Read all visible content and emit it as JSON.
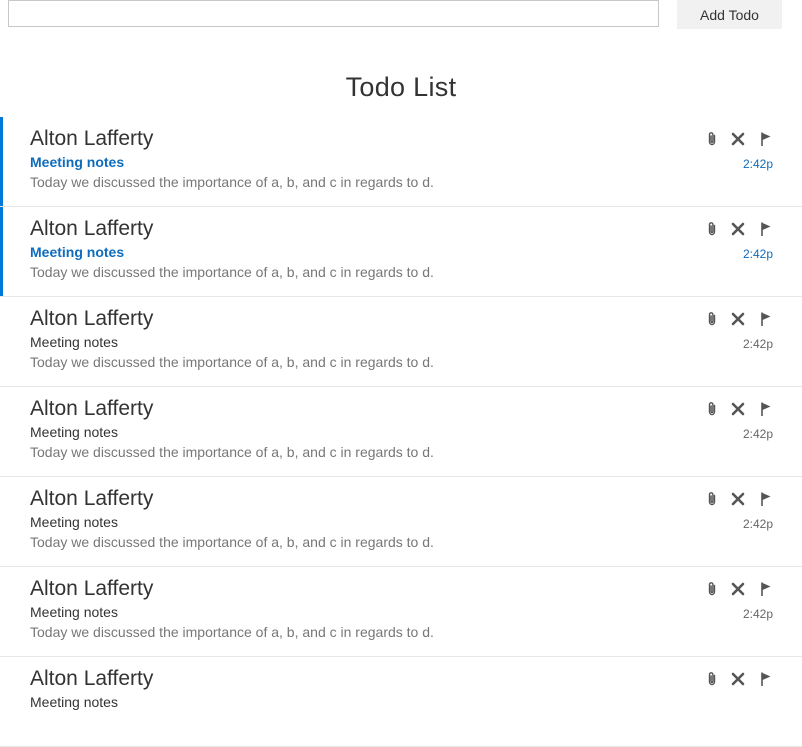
{
  "top": {
    "input_value": "",
    "input_placeholder": "",
    "add_label": "Add Todo"
  },
  "title": "Todo List",
  "items": [
    {
      "sender": "Alton Lafferty",
      "subject": "Meeting notes",
      "preview": "Today we discussed the importance of a, b, and c in regards to d.",
      "time": "2:42p",
      "unread": true
    },
    {
      "sender": "Alton Lafferty",
      "subject": "Meeting notes",
      "preview": "Today we discussed the importance of a, b, and c in regards to d.",
      "time": "2:42p",
      "unread": true
    },
    {
      "sender": "Alton Lafferty",
      "subject": "Meeting notes",
      "preview": "Today we discussed the importance of a, b, and c in regards to d.",
      "time": "2:42p",
      "unread": false
    },
    {
      "sender": "Alton Lafferty",
      "subject": "Meeting notes",
      "preview": "Today we discussed the importance of a, b, and c in regards to d.",
      "time": "2:42p",
      "unread": false
    },
    {
      "sender": "Alton Lafferty",
      "subject": "Meeting notes",
      "preview": "Today we discussed the importance of a, b, and c in regards to d.",
      "time": "2:42p",
      "unread": false
    },
    {
      "sender": "Alton Lafferty",
      "subject": "Meeting notes",
      "preview": "Today we discussed the importance of a, b, and c in regards to d.",
      "time": "2:42p",
      "unread": false
    },
    {
      "sender": "Alton Lafferty",
      "subject": "Meeting notes",
      "preview": "",
      "time": "",
      "unread": false
    }
  ],
  "icons": {
    "attach": "paperclip-icon",
    "delete": "close-icon",
    "flag": "flag-icon"
  },
  "colors": {
    "accent": "#0078d7",
    "unread_text": "#0f6cbd",
    "button_bg": "#f1f1f1"
  }
}
